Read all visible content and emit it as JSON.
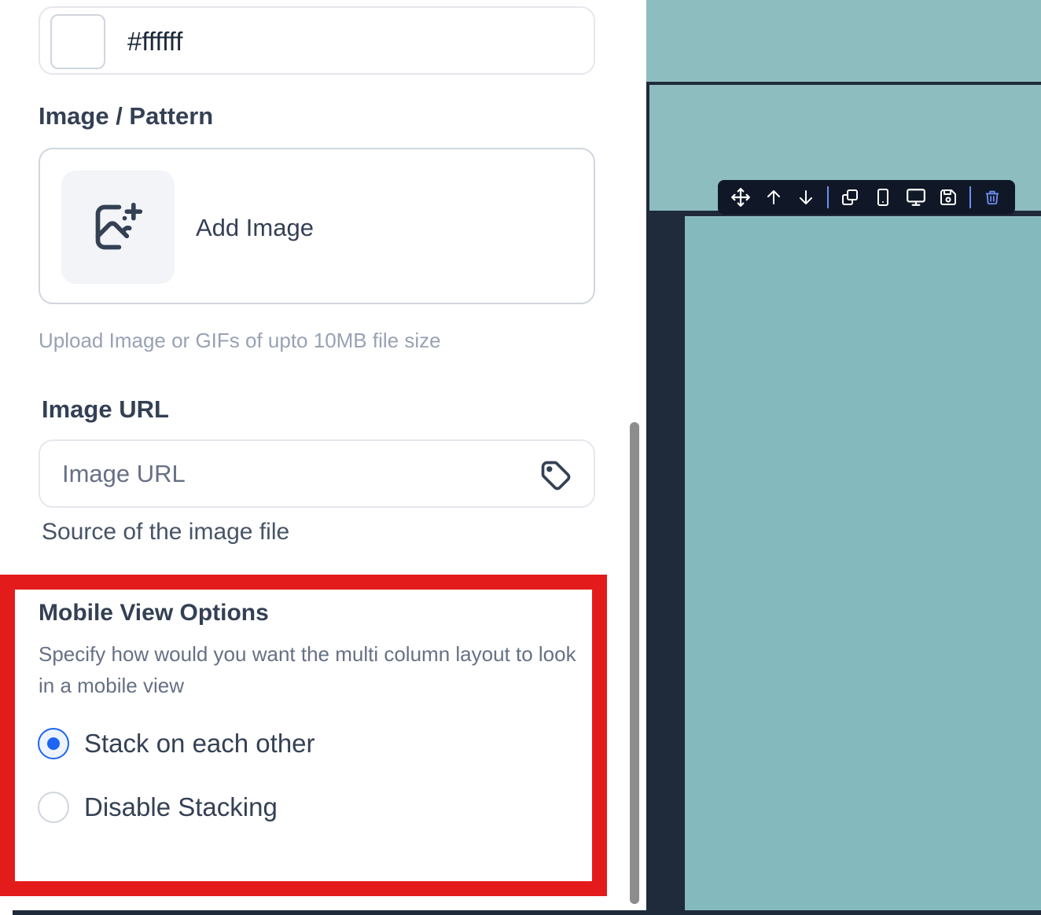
{
  "color_field": {
    "value": "#ffffff",
    "swatch_color": "#ffffff"
  },
  "image_section": {
    "title": "Image / Pattern",
    "add_image_label": "Add Image",
    "help_text": "Upload Image or GIFs of upto 10MB file size"
  },
  "image_url": {
    "label": "Image URL",
    "placeholder": "Image URL",
    "value": "",
    "description": "Source of the image file"
  },
  "mobile_view": {
    "title": "Mobile View Options",
    "description": "Specify how would you want the multi column layout to look in a mobile view",
    "options": [
      {
        "label": "Stack on each other",
        "selected": true
      },
      {
        "label": "Disable Stacking",
        "selected": false
      }
    ]
  },
  "element_toolbar": {
    "buttons": [
      "move-icon",
      "arrow-up-icon",
      "arrow-down-icon",
      "duplicate-icon",
      "mobile-icon",
      "desktop-icon",
      "save-icon",
      "trash-icon"
    ]
  },
  "colors": {
    "highlight": "#e41b1b",
    "radio_selected": "#1d64f2",
    "canvas_background": "#8ebdbf",
    "canvas_dark": "#1f2a3a"
  }
}
